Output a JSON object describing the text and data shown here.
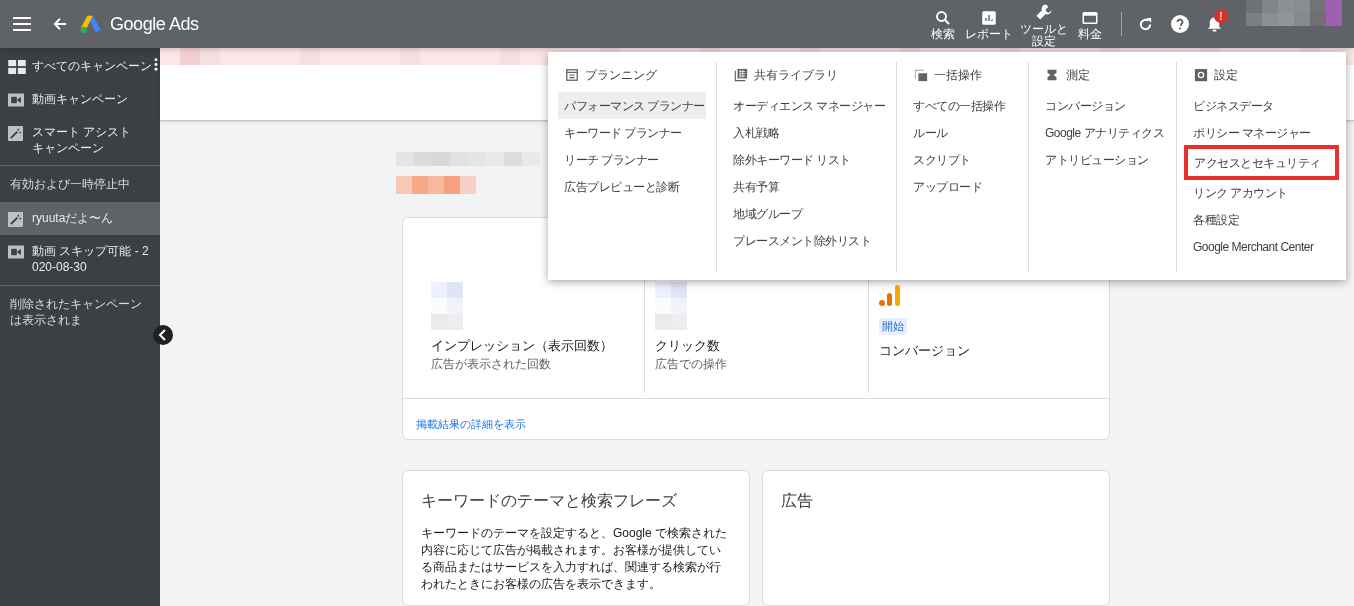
{
  "header": {
    "product": "Google Ads",
    "tools": [
      {
        "kind": "search",
        "label": "検索"
      },
      {
        "kind": "report",
        "label": "レポート"
      },
      {
        "kind": "wrench",
        "label": "ツールと設定"
      },
      {
        "kind": "billing",
        "label": "料金"
      }
    ],
    "notification_badge": "!"
  },
  "sidebar": {
    "items": [
      {
        "kind": "grid",
        "label": "すべてのキャンペーン",
        "selected": false,
        "more": true
      },
      {
        "kind": "video",
        "label": "動画キャンペーン",
        "selected": false,
        "more": false
      },
      {
        "kind": "wand",
        "label": "スマート アシストキャンペーン",
        "selected": false,
        "more": false
      }
    ],
    "section": "有効および一時停止中",
    "campaigns": [
      {
        "kind": "wand",
        "label": "ryuutaだよ〜ん",
        "selected": true
      },
      {
        "kind": "video",
        "label": "動画 スキップ可能 - 2020-08-30",
        "selected": false
      }
    ],
    "footer": "削除されたキャンペーンは表示されま"
  },
  "menu": {
    "columns": [
      {
        "kind": "calendar",
        "title": "プランニング",
        "items": [
          {
            "label": "パフォーマンス プランナー",
            "selected": true,
            "highlighted": false
          },
          {
            "label": "キーワード プランナー",
            "selected": false,
            "highlighted": false
          },
          {
            "label": "リーチ プランナー",
            "selected": false,
            "highlighted": false
          },
          {
            "label": "広告プレビューと診断",
            "selected": false,
            "highlighted": false
          }
        ]
      },
      {
        "kind": "library",
        "title": "共有ライブラリ",
        "items": [
          {
            "label": "オーディエンス マネージャー",
            "selected": false,
            "highlighted": false
          },
          {
            "label": "入札戦略",
            "selected": false,
            "highlighted": false
          },
          {
            "label": "除外キーワード リスト",
            "selected": false,
            "highlighted": false
          },
          {
            "label": "共有予算",
            "selected": false,
            "highlighted": false
          },
          {
            "label": "地域グループ",
            "selected": false,
            "highlighted": false
          },
          {
            "label": "プレースメント除外リスト",
            "selected": false,
            "highlighted": false
          }
        ]
      },
      {
        "kind": "copies",
        "title": "一括操作",
        "items": [
          {
            "label": "すべての一括操作",
            "selected": false,
            "highlighted": false
          },
          {
            "label": "ルール",
            "selected": false,
            "highlighted": false
          },
          {
            "label": "スクリプト",
            "selected": false,
            "highlighted": false
          },
          {
            "label": "アップロード",
            "selected": false,
            "highlighted": false
          }
        ]
      },
      {
        "kind": "hourglass",
        "title": "測定",
        "items": [
          {
            "label": "コンバージョン",
            "selected": false,
            "highlighted": false
          },
          {
            "label": "Google アナリティクス",
            "selected": false,
            "highlighted": false
          },
          {
            "label": "アトリビューション",
            "selected": false,
            "highlighted": false
          }
        ]
      },
      {
        "kind": "settings",
        "title": "設定",
        "items": [
          {
            "label": "ビジネスデータ",
            "selected": false,
            "highlighted": false
          },
          {
            "label": "ポリシー マネージャー",
            "selected": false,
            "highlighted": false
          },
          {
            "label": "アクセスとセキュリティ",
            "selected": false,
            "highlighted": true
          },
          {
            "label": "リンク アカウント",
            "selected": false,
            "highlighted": false
          },
          {
            "label": "各種設定",
            "selected": false,
            "highlighted": false
          },
          {
            "label": "Google Merchant Center",
            "selected": false,
            "highlighted": false
          }
        ]
      }
    ]
  },
  "summary": {
    "metrics": [
      {
        "kind": "blurred",
        "title": "インプレッション（表示回数）",
        "caption": "広告が表示された回数"
      },
      {
        "kind": "blurred",
        "title": "クリック数",
        "caption": "広告での操作"
      },
      {
        "kind": "analytics",
        "badge": "開始",
        "title": "コンバージョン"
      }
    ],
    "link": "掲載結果の詳細を表示"
  },
  "cards": [
    {
      "title": "キーワードのテーマと検索フレーズ",
      "body": "キーワードのテーマを設定すると、Google で検索された内容に応じて広告が掲載されます。お客様が提供している商品またはサービスを入力すれば、関連する検索が行われたときにお客様の広告を表示できます。"
    },
    {
      "title": "広告"
    }
  ]
}
